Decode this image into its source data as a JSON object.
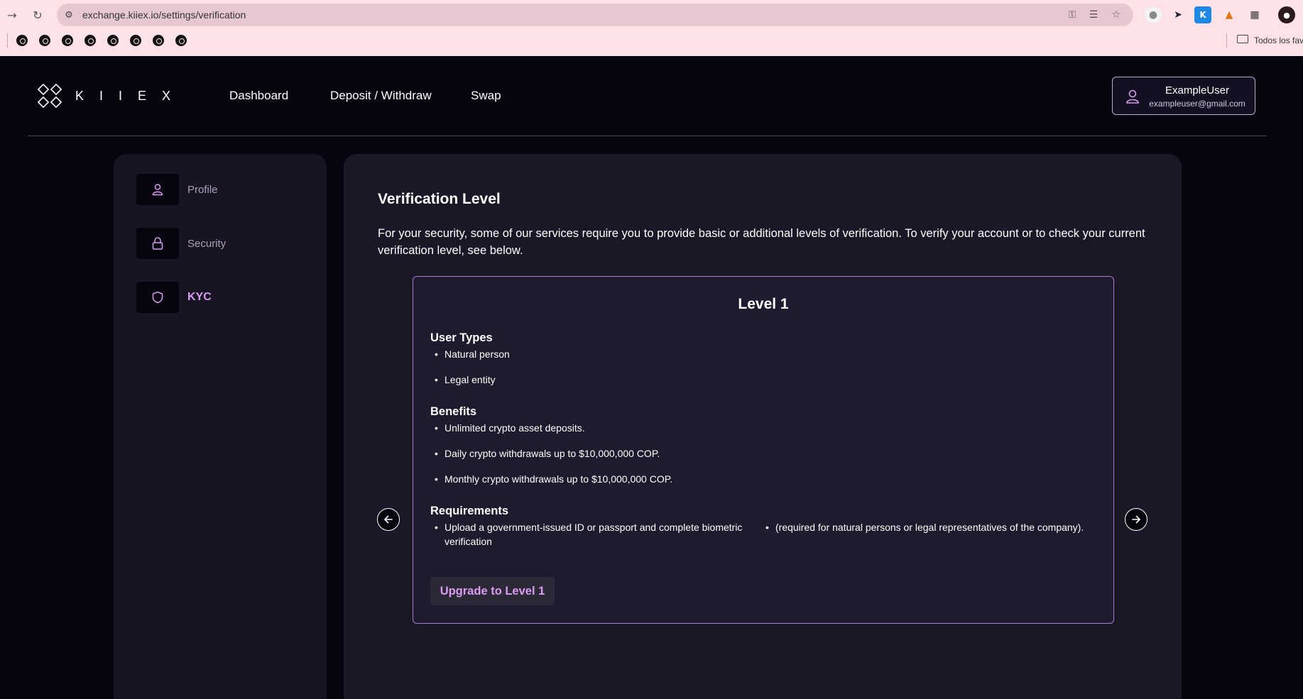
{
  "browser": {
    "url": "exchange.kiiex.io/settings/verification",
    "bookmarks_all_label": "Todos los fav"
  },
  "app": {
    "logo_text": "KIIEX",
    "nav": [
      "Dashboard",
      "Deposit / Withdraw",
      "Swap"
    ],
    "user": {
      "name": "ExampleUser",
      "email": "exampleuser@gmail.com"
    }
  },
  "sidebar": {
    "items": [
      {
        "label": "Profile",
        "icon": "user-icon",
        "active": false
      },
      {
        "label": "Security",
        "icon": "lock-icon",
        "active": false
      },
      {
        "label": "KYC",
        "icon": "shield-icon",
        "active": true
      }
    ]
  },
  "main": {
    "title": "Verification Level",
    "description": "For your security, some of our services require you to provide basic or additional levels of verification. To verify your account or to check your current verification level, see below.",
    "card": {
      "level_title": "Level 1",
      "user_types_title": "User Types",
      "user_types": [
        "Natural person",
        "Legal entity"
      ],
      "benefits_title": "Benefits",
      "benefits": [
        "Unlimited crypto asset deposits.",
        "Daily crypto withdrawals up to $10,000,000 COP.",
        "Monthly crypto withdrawals up to $10,000,000 COP."
      ],
      "requirements_title": "Requirements",
      "requirements": [
        "Upload a government-issued ID or passport and complete biometric verification",
        "(required for natural persons or legal representatives of the company)."
      ],
      "upgrade_label": "Upgrade to Level 1"
    }
  },
  "colors": {
    "background": "#06040f",
    "panel": "#1b1727",
    "accent": "#d89df0",
    "card_border": "#a77bd0"
  }
}
